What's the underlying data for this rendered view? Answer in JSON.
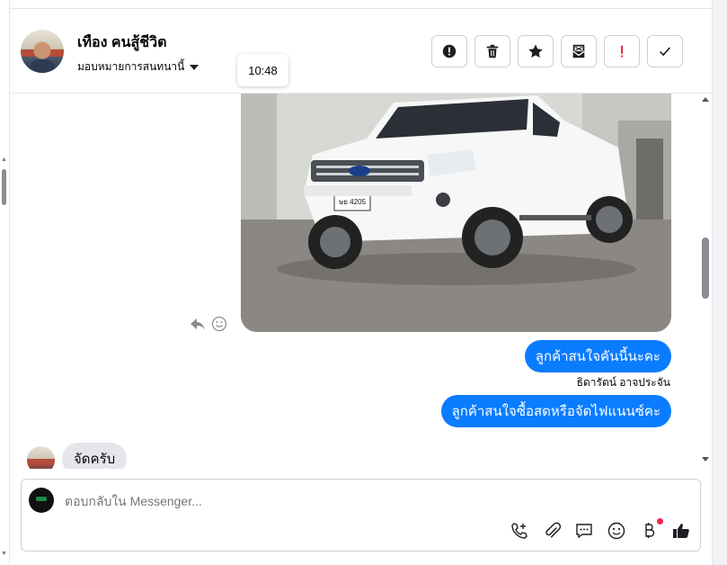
{
  "header": {
    "contact_name": "เทือง คนสู้ชีวิต",
    "assign_label": "มอบหมายการสนทนานี้",
    "time_tooltip": "10:48",
    "tools": [
      {
        "name": "report-spam-button",
        "icon": "exclamation-circle-icon"
      },
      {
        "name": "delete-button",
        "icon": "trash-icon"
      },
      {
        "name": "star-button",
        "icon": "star-icon"
      },
      {
        "name": "mark-unread-button",
        "icon": "envelope-open-icon"
      },
      {
        "name": "mark-important-button",
        "icon": "exclamation-icon"
      },
      {
        "name": "mark-done-button",
        "icon": "checkmark-icon"
      }
    ]
  },
  "messages": {
    "out_1": "ลูกค้าสนใจคันนี้นะคะ",
    "sender_name": "ธิดารัตน์ อาจประจัน",
    "out_2": "ลูกค้าสนใจซื้อสดหรือจัดไฟแนนซ์คะ",
    "in_1": "จัดครับ",
    "photo": {
      "plate": "ษย 4205"
    }
  },
  "composer": {
    "placeholder": "ตอบกลับใน Messenger...",
    "icons": [
      "phone-add-icon",
      "paperclip-icon",
      "saved-reply-icon",
      "emoji-icon",
      "baht-icon",
      "thumbs-up-icon"
    ]
  },
  "colors": {
    "accent": "#0a7cff",
    "incoming_bubble": "#e4e6eb",
    "important": "#e41e3f",
    "notification": "#f02849"
  }
}
